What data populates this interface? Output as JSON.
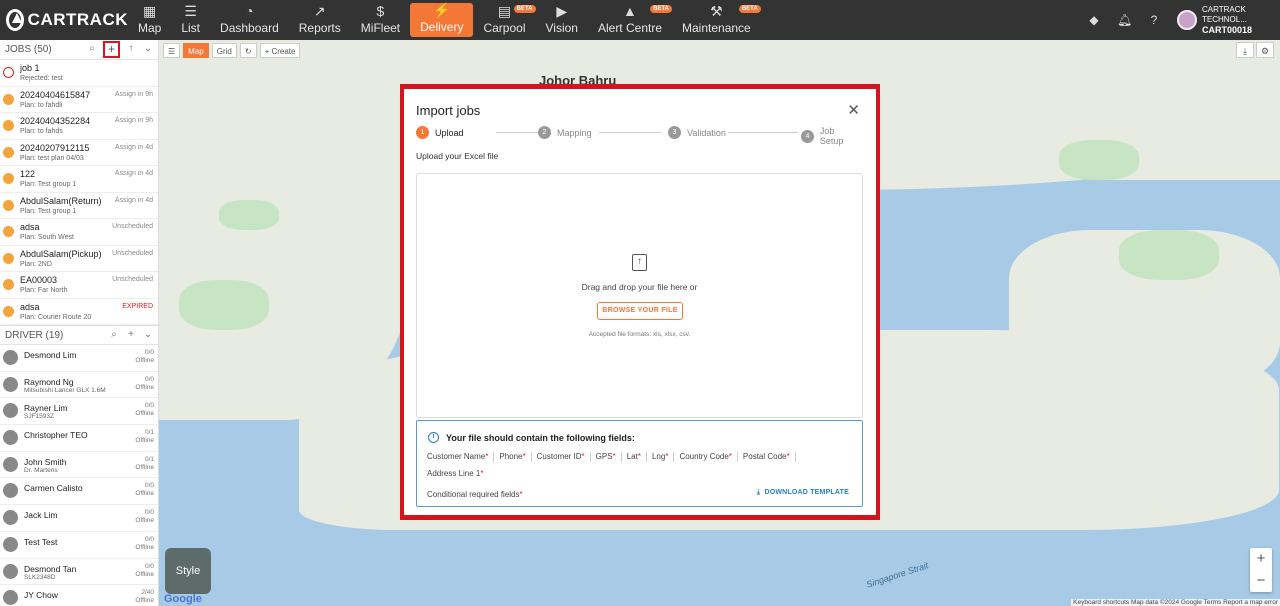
{
  "brand": {
    "name": "CARTRACK"
  },
  "nav": [
    {
      "label": "Map",
      "icon": "map-icon",
      "active": false,
      "beta": false
    },
    {
      "label": "List",
      "icon": "list-icon",
      "active": false,
      "beta": false
    },
    {
      "label": "Dashboard",
      "icon": "dashboard-icon",
      "active": false,
      "beta": false
    },
    {
      "label": "Reports",
      "icon": "chart-icon",
      "active": false,
      "beta": false
    },
    {
      "label": "MiFleet",
      "icon": "dollar-icon",
      "active": false,
      "beta": false
    },
    {
      "label": "Delivery",
      "icon": "bolt-icon",
      "active": true,
      "beta": false
    },
    {
      "label": "Carpool",
      "icon": "calendar-icon",
      "active": false,
      "beta": true
    },
    {
      "label": "Vision",
      "icon": "camera-icon",
      "active": false,
      "beta": false
    },
    {
      "label": "Alert Centre",
      "icon": "bell-icon",
      "active": false,
      "beta": true
    },
    {
      "label": "Maintenance",
      "icon": "wrench-icon",
      "active": false,
      "beta": true
    }
  ],
  "beta_label": "BETA",
  "account": {
    "company": "CARTRACK TECHNOL...",
    "id": "CART00018"
  },
  "jobs": {
    "header": "JOBS (50)",
    "items": [
      {
        "title": "job 1",
        "sub": "Rejected: test",
        "status": "",
        "error": true
      },
      {
        "title": "20240404615847",
        "sub": "Plan: to fahdli",
        "status": "Assign in 9h",
        "error": false
      },
      {
        "title": "20240404352284",
        "sub": "Plan: to fahds",
        "status": "Assign in 9h",
        "error": false
      },
      {
        "title": "20240207912115",
        "sub": "Plan: test plan 04/03",
        "status": "Assign in 4d",
        "error": false
      },
      {
        "title": "122",
        "sub": "Plan: Test group 1",
        "status": "Assign in 4d",
        "error": false
      },
      {
        "title": "AbdulSalam(Return)",
        "sub": "Plan: Test group 1",
        "status": "Assign in 4d",
        "error": false
      },
      {
        "title": "adsa",
        "sub": "Plan: South West",
        "status": "Unscheduled",
        "error": false
      },
      {
        "title": "AbdulSalam(Pickup)",
        "sub": "Plan: 2ND",
        "status": "Unscheduled",
        "error": false
      },
      {
        "title": "EA00003",
        "sub": "Plan: Far North",
        "status": "Unscheduled",
        "error": false
      },
      {
        "title": "adsa",
        "sub": "Plan: Courier Route 20",
        "status": "EXPIRED",
        "error": false
      }
    ]
  },
  "drivers": {
    "header": "DRIVER (19)",
    "items": [
      {
        "name": "Desmond Lim",
        "sub": "",
        "count": "0/0",
        "state": "Offline"
      },
      {
        "name": "Raymond Ng",
        "sub": "Mitsubishi Lancer GLX 1.6M",
        "count": "0/0",
        "state": "Offline"
      },
      {
        "name": "Rayner Lim",
        "sub": "SJF1593Z",
        "count": "0/0",
        "state": "Offline"
      },
      {
        "name": "Christopher TEO",
        "sub": "",
        "count": "0/1",
        "state": "Offline"
      },
      {
        "name": "John Smith",
        "sub": "Dr. Martens",
        "count": "0/1",
        "state": "Offline"
      },
      {
        "name": "Carmen Calisto",
        "sub": "",
        "count": "0/0",
        "state": "Offline"
      },
      {
        "name": "Jack Lim",
        "sub": "",
        "count": "0/0",
        "state": "Offline"
      },
      {
        "name": "Test Test",
        "sub": "",
        "count": "0/0",
        "state": "Offline"
      },
      {
        "name": "Desmond Tan",
        "sub": "SLK2348D",
        "count": "0/0",
        "state": "Offline"
      },
      {
        "name": "JY Chow",
        "sub": "",
        "count": "2/40",
        "state": "Offline"
      }
    ]
  },
  "map": {
    "tools": {
      "map": "Map",
      "grid": "Grid",
      "create": "Create"
    },
    "style_label": "Style",
    "google": "Google",
    "attribution": "Keyboard shortcuts   Map data ©2024 Google   Terms   Report a map error",
    "labels": [
      {
        "text": "Johor Bahru",
        "cls": "big"
      },
      {
        "text": "Singapore Strait",
        "cls": "water"
      }
    ]
  },
  "modal": {
    "title": "Import jobs",
    "steps": [
      {
        "num": "1",
        "label": "Upload"
      },
      {
        "num": "2",
        "label": "Mapping"
      },
      {
        "num": "3",
        "label": "Validation"
      },
      {
        "num": "4",
        "label": "Job Setup"
      }
    ],
    "upload_label": "Upload your Excel file",
    "drop_text": "Drag and drop your file here or",
    "browse_button": "BROWSE YOUR FILE",
    "formats": "Accepted file formats: xls, xlsx, csv.",
    "fields_title": "Your file should contain the following fields:",
    "fields": [
      "Customer Name",
      "Phone",
      "Customer ID",
      "GPS",
      "Lat",
      "Lng",
      "Country Code",
      "Postal Code",
      "Address Line 1"
    ],
    "conditional": "Conditional required fields",
    "download_button": "DOWNLOAD TEMPLATE"
  },
  "colors": {
    "accent": "#f47735",
    "highlight": "#d3141d",
    "info": "#2a7fbf"
  }
}
